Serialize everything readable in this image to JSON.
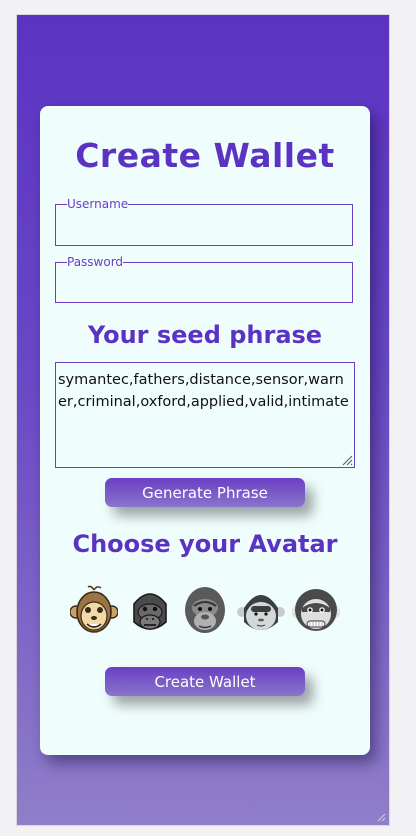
{
  "card": {
    "title": "Create Wallet"
  },
  "form": {
    "username_legend": "Username",
    "username_value": "",
    "password_legend": "Password",
    "password_value": ""
  },
  "seed": {
    "heading": "Your seed phrase",
    "phrase": "symantec,fathers,distance,sensor,warner,criminal,oxford,applied,valid,intimate",
    "generate_label": "Generate Phrase"
  },
  "avatar": {
    "heading": "Choose your Avatar",
    "options": [
      "monkey-icon",
      "gorilla-icon",
      "gorilla-gray-icon",
      "gorilla-silver-icon",
      "ape-icon"
    ]
  },
  "actions": {
    "create_label": "Create Wallet"
  },
  "colors": {
    "accent": "#5b33c2",
    "card_bg": "#f0fdfd",
    "border": "#6a3fc4"
  }
}
